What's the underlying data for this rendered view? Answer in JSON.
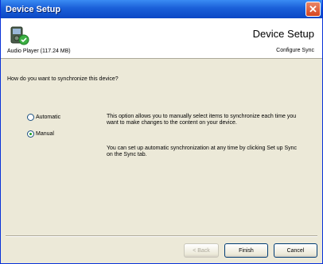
{
  "window": {
    "title": "Device Setup",
    "close_glyph": "✕"
  },
  "header": {
    "device_name": "Audio Player (117.24 MB)",
    "title": "Device Setup",
    "subtitle": "Configure Sync",
    "icon": "audio-player-device-icon"
  },
  "body": {
    "question": "How do you want to synchronize this device?",
    "options": [
      {
        "label": "Automatic",
        "checked": false
      },
      {
        "label": "Manual",
        "checked": true
      }
    ],
    "description_1": "This option allows you to manually select items to synchronize each time you want to make changes to the content on your device.",
    "description_2": "You can set up automatic synchronization at any time by clicking Set up Sync on the Sync tab."
  },
  "buttons": {
    "back": "< Back",
    "finish": "Finish",
    "cancel": "Cancel"
  },
  "colors": {
    "titlebar": "#0b47c5",
    "panel": "#ece9d8",
    "radio_dot": "#21a121"
  }
}
